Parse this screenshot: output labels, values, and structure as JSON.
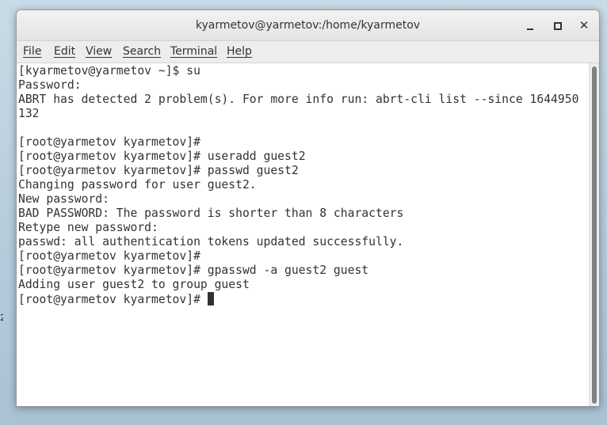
{
  "window": {
    "title": "kyarmetov@yarmetov:/home/kyarmetov",
    "controls": {
      "minimize_icon": "minimize-icon",
      "maximize_icon": "maximize-icon",
      "close_glyph": "✕"
    }
  },
  "desktop": {
    "edge_text": "2"
  },
  "menubar": {
    "items": [
      "File",
      "Edit",
      "View",
      "Search",
      "Terminal",
      "Help"
    ]
  },
  "terminal": {
    "lines": [
      "[kyarmetov@yarmetov ~]$ su",
      "Password:",
      "ABRT has detected 2 problem(s). For more info run: abrt-cli list --since 1644950",
      "132",
      "",
      "[root@yarmetov kyarmetov]#",
      "[root@yarmetov kyarmetov]# useradd guest2",
      "[root@yarmetov kyarmetov]# passwd guest2",
      "Changing password for user guest2.",
      "New password:",
      "BAD PASSWORD: The password is shorter than 8 characters",
      "Retype new password:",
      "passwd: all authentication tokens updated successfully.",
      "[root@yarmetov kyarmetov]#",
      "[root@yarmetov kyarmetov]# gpasswd -a guest2 guest",
      "Adding user guest2 to group guest"
    ],
    "prompt": "[root@yarmetov kyarmetov]# "
  },
  "colors": {
    "terminal_bg": "#ffffff",
    "terminal_fg": "#2e3436",
    "chrome_bg": "#ededed"
  }
}
